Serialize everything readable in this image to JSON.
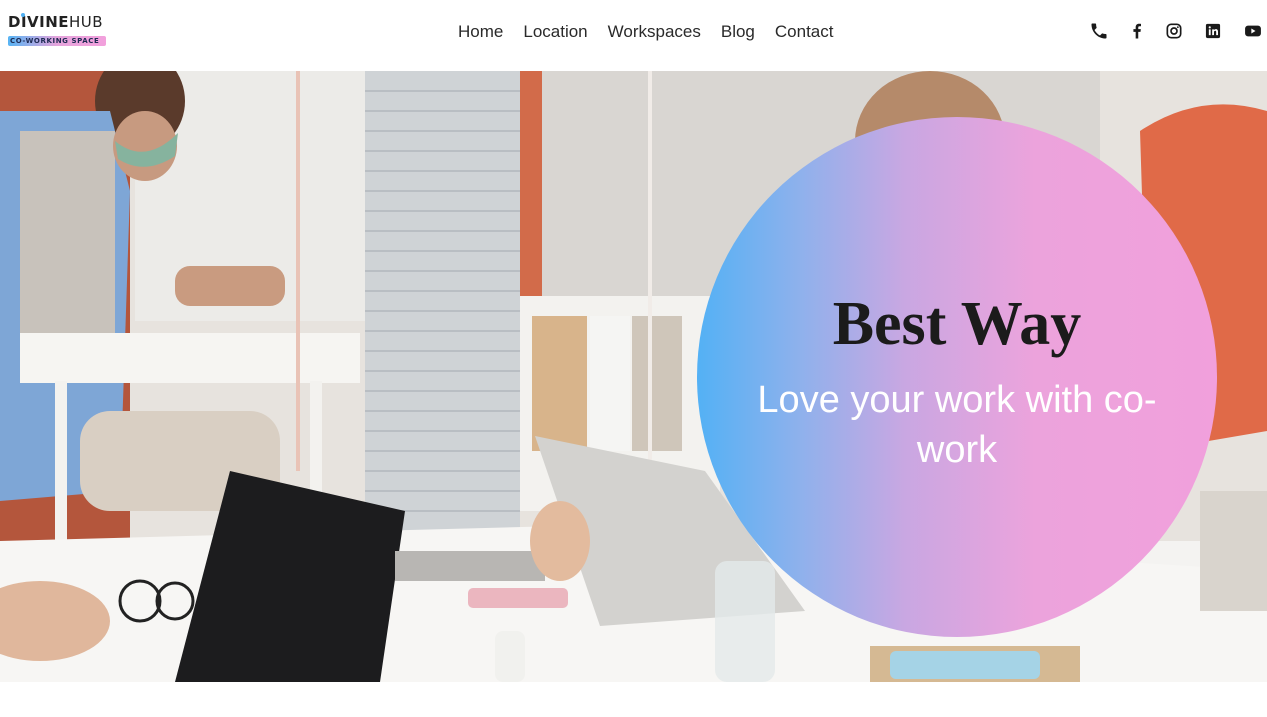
{
  "brand": {
    "name_bold": "DIVINE",
    "name_light": "HUB",
    "tagline": "CO-WORKING SPACE"
  },
  "nav": {
    "items": [
      "Home",
      "Location",
      "Workspaces",
      "Blog",
      "Contact"
    ]
  },
  "social": {
    "icons": [
      "phone-icon",
      "facebook-icon",
      "instagram-icon",
      "linkedin-icon",
      "youtube-icon"
    ]
  },
  "hero": {
    "title": "Best Way",
    "subtitle": "Love your work with co-work",
    "gradient": [
      "#53b1f5",
      "#f1a0dc"
    ]
  },
  "colors": {
    "text": "#2a2a2a",
    "title": "#1b1b1b",
    "subtitle": "#ffffff"
  }
}
